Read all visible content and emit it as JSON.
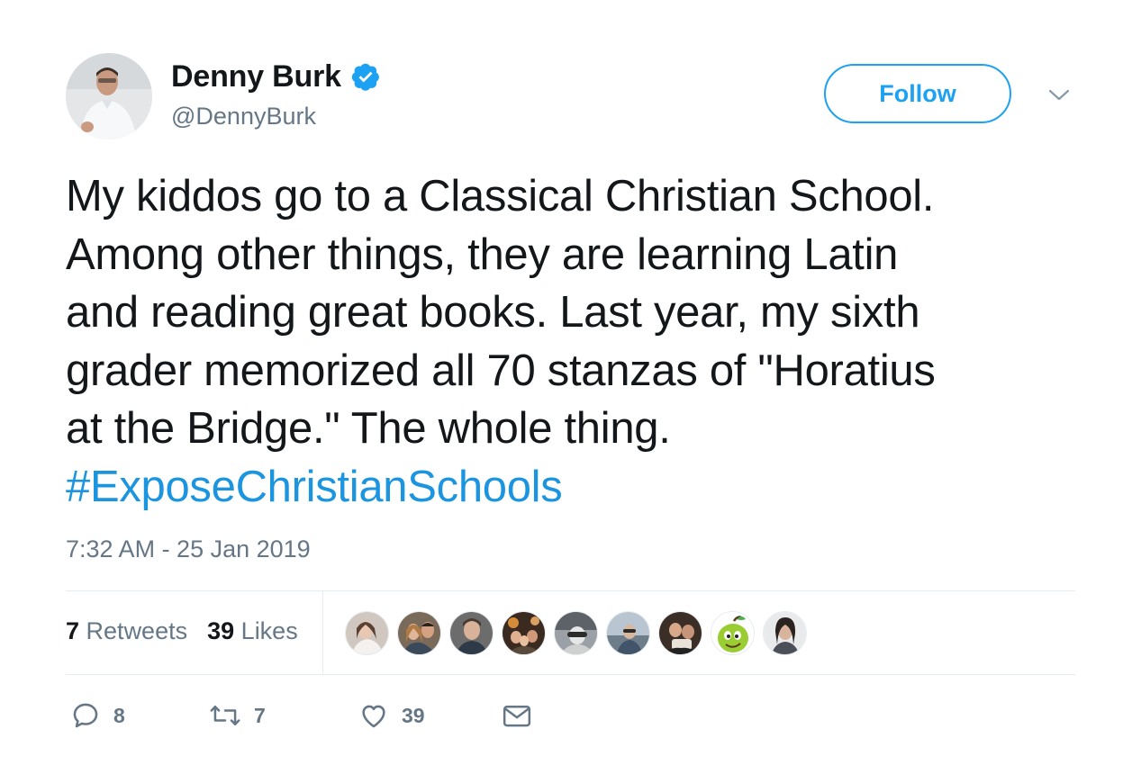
{
  "author": {
    "display_name": "Denny Burk",
    "handle": "@DennyBurk",
    "verified": true
  },
  "follow_button_label": "Follow",
  "tweet": {
    "lines": [
      "My kiddos go to a Classical Christian School.",
      "Among other things, they are learning Latin",
      "and reading great books. Last year, my sixth",
      "grader memorized all 70 stanzas of \"Horatius",
      "at the Bridge.\" The whole thing."
    ],
    "hashtag": "#ExposeChristianSchools",
    "timestamp": "7:32 AM - 25 Jan 2019"
  },
  "stats": {
    "retweets_count": "7",
    "retweets_label": "Retweets",
    "likes_count": "39",
    "likes_label": "Likes"
  },
  "liker_avatars": [
    "liker-avatar-1",
    "liker-avatar-2",
    "liker-avatar-3",
    "liker-avatar-4",
    "liker-avatar-5",
    "liker-avatar-6",
    "liker-avatar-7",
    "liker-avatar-8",
    "liker-avatar-9"
  ],
  "actions": {
    "reply_count": "8",
    "retweet_count": "7",
    "like_count": "39"
  },
  "colors": {
    "accent": "#1da1f2",
    "hashtag": "#1b95e0",
    "muted": "#657786",
    "text": "#14171a",
    "divider": "#e6ecf0"
  }
}
